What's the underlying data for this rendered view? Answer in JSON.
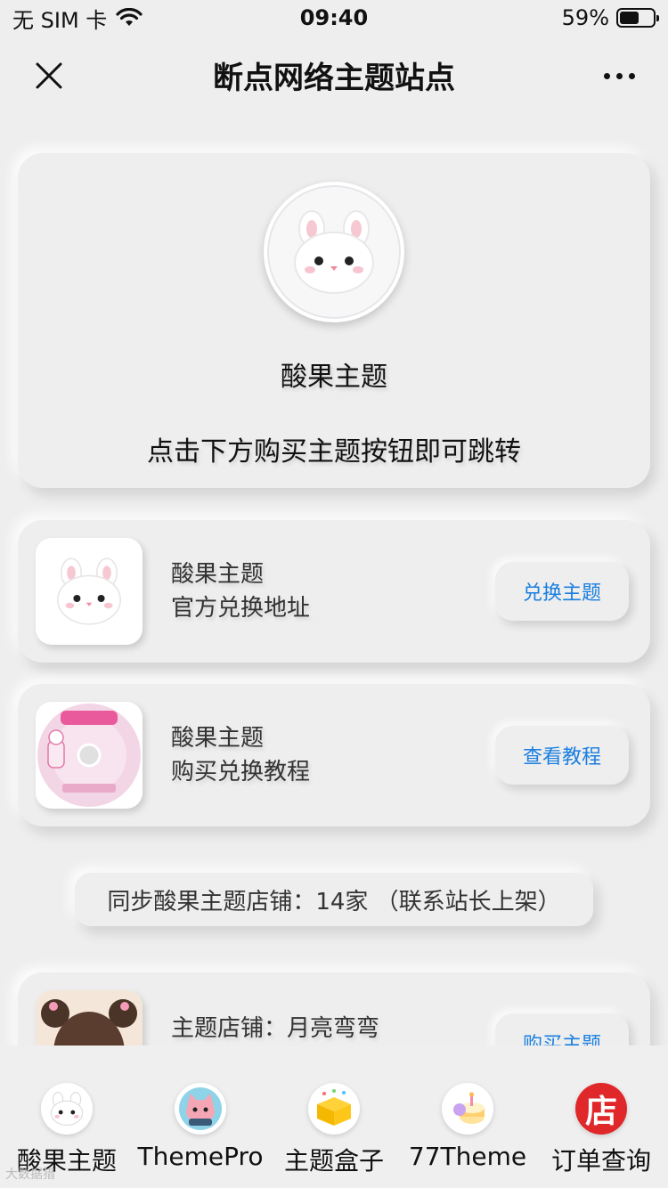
{
  "status": {
    "carrier": "无 SIM 卡",
    "time": "09:40",
    "battery": "59%",
    "battery_level": 0.59
  },
  "nav": {
    "title": "断点网络主题站点"
  },
  "hero": {
    "title": "酸果主题",
    "subtitle": "点击下方购买主题按钮即可跳转"
  },
  "cards": [
    {
      "line1": "酸果主题",
      "line2": "官方兑换地址",
      "button": "兑换主题"
    },
    {
      "line1": "酸果主题",
      "line2": "购买兑换教程",
      "button": "查看教程"
    },
    {
      "line1": "主题店铺：月亮弯弯",
      "line2": "",
      "button": "购买主题"
    }
  ],
  "stores_notice": "同步酸果主题店铺：14家 （联系站长上架）",
  "tabs": [
    {
      "label": "酸果主题",
      "icon": "bunny-icon"
    },
    {
      "label": "ThemePro",
      "icon": "cat-icon"
    },
    {
      "label": "主题盒子",
      "icon": "gift-box-icon"
    },
    {
      "label": "77Theme",
      "icon": "cake-icon"
    },
    {
      "label": "订单查询",
      "icon": "store-icon",
      "icon_text": "店"
    }
  ],
  "watermark": "大数据猎"
}
